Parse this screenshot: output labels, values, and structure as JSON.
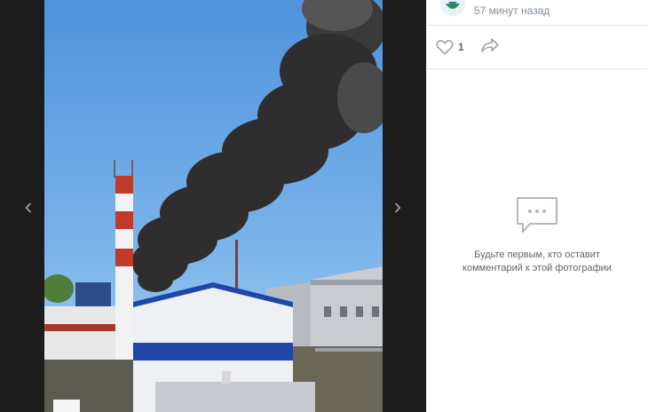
{
  "photo_viewer": {
    "prev_arrow": "‹",
    "next_arrow": "›",
    "photo_subject": "black smoke plume over industrial site"
  },
  "post": {
    "time": "57 минут назад",
    "likes": "1"
  },
  "comments": {
    "empty_text": "Будьте первым, кто оставит комментарий к этой фотографии"
  },
  "colors": {
    "sky": "#5f9fe0",
    "smoke": "#2b2b2b",
    "panel_text": "#656565",
    "meta_text": "#818c99",
    "icon_accent": "#99a2ad"
  }
}
